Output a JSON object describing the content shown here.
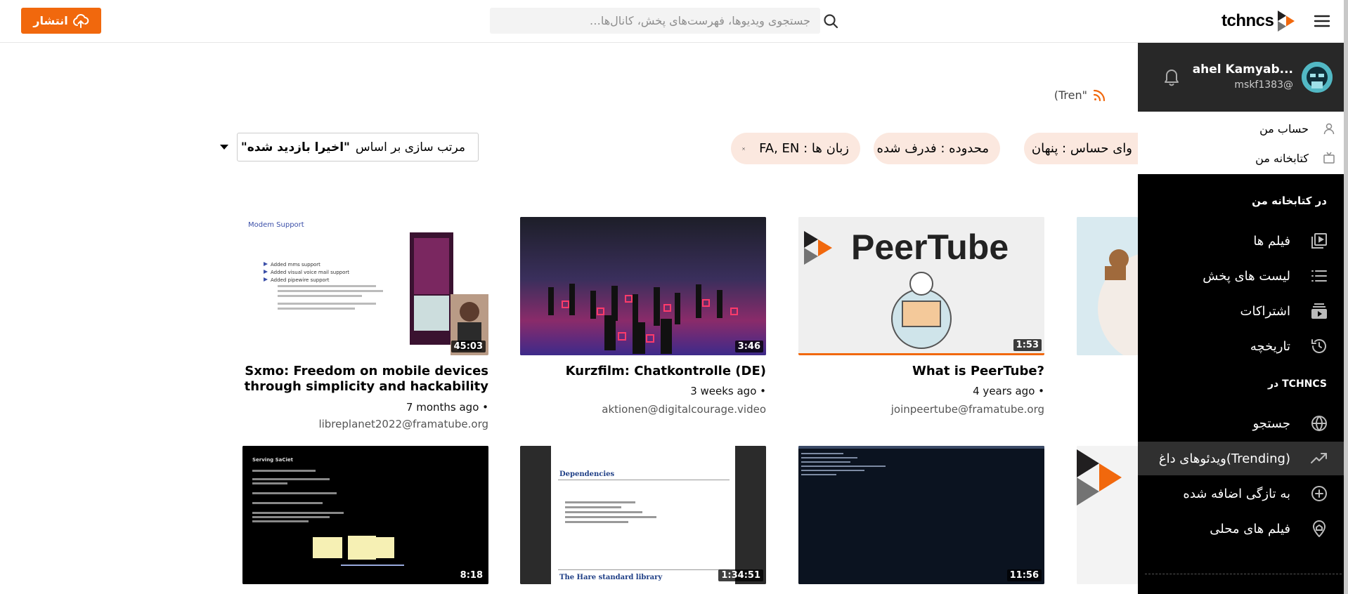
{
  "header": {
    "publish_label": "انتشار",
    "search_placeholder": "جستجوی ویدیوها، فهرست‌های پخش، کانال‌ها…",
    "logo_text": "tchncs"
  },
  "sidebar": {
    "user": {
      "name": "ahel Kamyab...",
      "handle": "mskf1383@"
    },
    "account_links": [
      {
        "label": "حساب من",
        "icon": "user-icon"
      },
      {
        "label": "کتابخانه من",
        "icon": "tv-icon"
      }
    ],
    "library_title": "در کتابخانه من",
    "library_items": [
      {
        "label": "فیلم ها",
        "icon": "video-library-icon"
      },
      {
        "label": "لیست های پخش",
        "icon": "list-icon"
      },
      {
        "label": "اشتراکات",
        "icon": "subscriptions-icon"
      },
      {
        "label": "تاریخچه",
        "icon": "history-icon"
      }
    ],
    "instance_title": "در TCHNCS",
    "instance_items": [
      {
        "label": "جستجو",
        "icon": "globe-icon"
      },
      {
        "label": "ویدئوهای داغ(Trending)",
        "icon": "trending-icon"
      },
      {
        "label": "به تازگی اضافه شده",
        "icon": "plus-circle-icon"
      },
      {
        "label": "فیلم های محلی",
        "icon": "home-icon"
      }
    ]
  },
  "feed": {
    "text": "(Tren\""
  },
  "filters": {
    "chip_sensitive": "وای حساس : پنهان",
    "chip_scope": "محدوده : فدرف شده",
    "chip_languages": "زبان ها : FA, EN",
    "sort_prefix": "مرتب سازی بر اساس",
    "sort_value": "\"اخیرا بازدید شده\""
  },
  "videos": [
    {
      "title_line1": "Sxmo: Freedom on mobile devices",
      "title_line2": "through simplicity and hackability",
      "age": "7 months ago •",
      "channel": "libreplanet2022@framatube.org",
      "duration": "45:03"
    },
    {
      "title_line1": "Kurzfilm: Chatkontrolle (DE)",
      "title_line2": "",
      "age": "3 weeks ago •",
      "channel": "aktionen@digitalcourage.video",
      "duration": "3:46"
    },
    {
      "title_line1": "What is PeerTube?",
      "title_line2": "",
      "age": "4 years ago •",
      "channel": "joinpeertube@framatube.org",
      "duration": "1:53",
      "thumb_text": "PeerTube"
    },
    {
      "title_line1": "",
      "title_line2": "",
      "age": "",
      "channel": "",
      "duration": "8:18",
      "slide_title": "Serving SaCiet"
    },
    {
      "title_line1": "",
      "title_line2": "",
      "age": "",
      "channel": "",
      "duration": "1:34:51",
      "slide_title": "Dependencies",
      "slide_footer": "The Hare standard library"
    },
    {
      "title_line1": "",
      "title_line2": "",
      "age": "",
      "channel": "",
      "duration": "11:56"
    }
  ],
  "slides": {
    "modem_title": "Modem Support",
    "modem_bullets": [
      "Added mms support",
      "Added visual voice mail support",
      "Added pipewire support"
    ]
  },
  "colors": {
    "accent": "#f1680d",
    "sidebar_bg": "#000000",
    "chip_bg": "#fbe8df"
  }
}
